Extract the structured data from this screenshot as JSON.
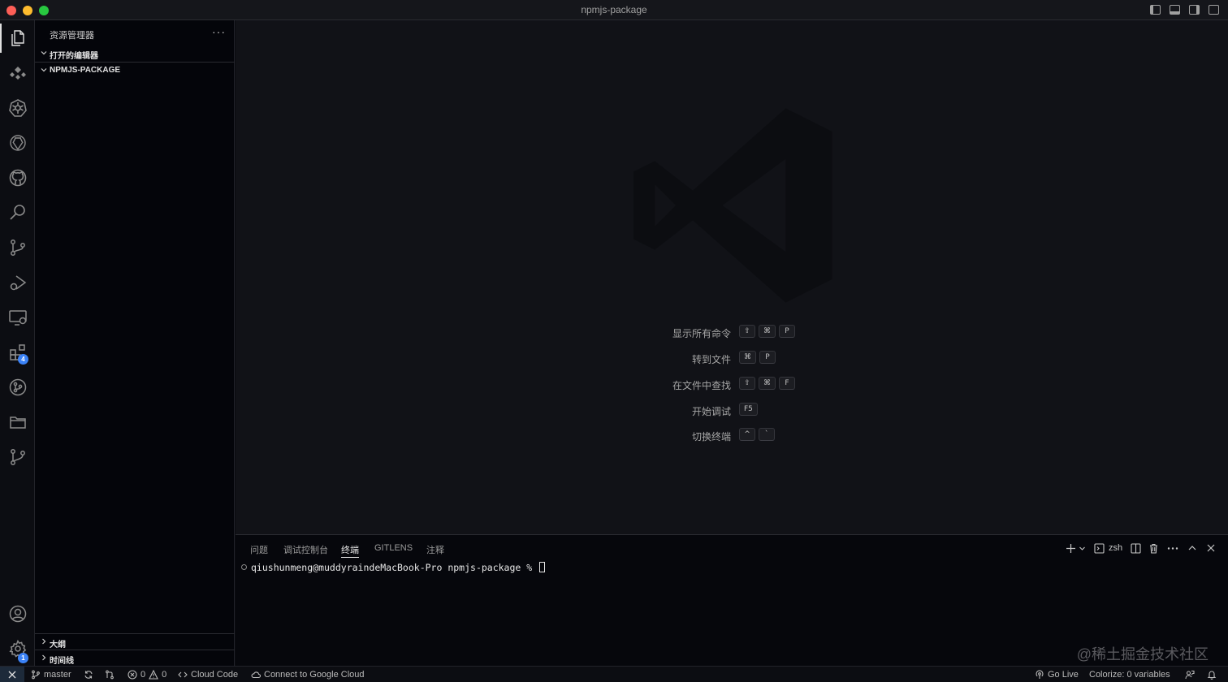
{
  "window": {
    "title": "npmjs-package"
  },
  "colors": {
    "traffic_close": "#fe5f57",
    "traffic_min": "#febc2e",
    "traffic_max": "#28c840",
    "badge": "#3b82f6"
  },
  "activity_bar": {
    "items": [
      {
        "name": "explorer-icon"
      },
      {
        "name": "remote-explorer-icon"
      },
      {
        "name": "kubernetes-icon"
      },
      {
        "name": "chatgpt-icon"
      },
      {
        "name": "github-icon"
      },
      {
        "name": "search-icon"
      },
      {
        "name": "source-control-icon"
      },
      {
        "name": "run-debug-icon"
      },
      {
        "name": "remote-window-icon"
      },
      {
        "name": "extensions-icon",
        "badge": "4"
      },
      {
        "name": "gitlens-icon"
      },
      {
        "name": "folder-icon"
      },
      {
        "name": "git-graph-icon"
      }
    ],
    "account_icon": "account-icon",
    "settings_icon": "settings-gear-icon",
    "settings_badge": "1"
  },
  "sidebar": {
    "title": "资源管理器",
    "more": "···",
    "sections": {
      "open_editors": "打开的编辑器",
      "project": "NPMJS-PACKAGE",
      "outline": "大纲",
      "timeline": "时间线"
    }
  },
  "editor": {
    "shortcuts": [
      {
        "label": "显示所有命令",
        "keys": [
          "⇧",
          "⌘",
          "P"
        ]
      },
      {
        "label": "转到文件",
        "keys": [
          "⌘",
          "P"
        ]
      },
      {
        "label": "在文件中查找",
        "keys": [
          "⇧",
          "⌘",
          "F"
        ]
      },
      {
        "label": "开始调试",
        "keys": [
          "F5"
        ]
      },
      {
        "label": "切换终端",
        "keys": [
          "^",
          "`"
        ]
      }
    ]
  },
  "panel": {
    "tabs": [
      "问题",
      "调试控制台",
      "终端",
      "GITLENS",
      "注释"
    ],
    "active_tab": "终端",
    "shell": "zsh",
    "prompt": "qiushunmeng@muddyraindeMacBook-Pro npmjs-package % "
  },
  "watermark": "@稀土掘金技术社区",
  "statusbar": {
    "branch": "master",
    "errors": "0",
    "warnings": "0",
    "cloud_code": "Cloud Code",
    "google_cloud": "Connect to Google Cloud",
    "go_live": "Go Live",
    "colorize": "Colorize: 0 variables"
  }
}
